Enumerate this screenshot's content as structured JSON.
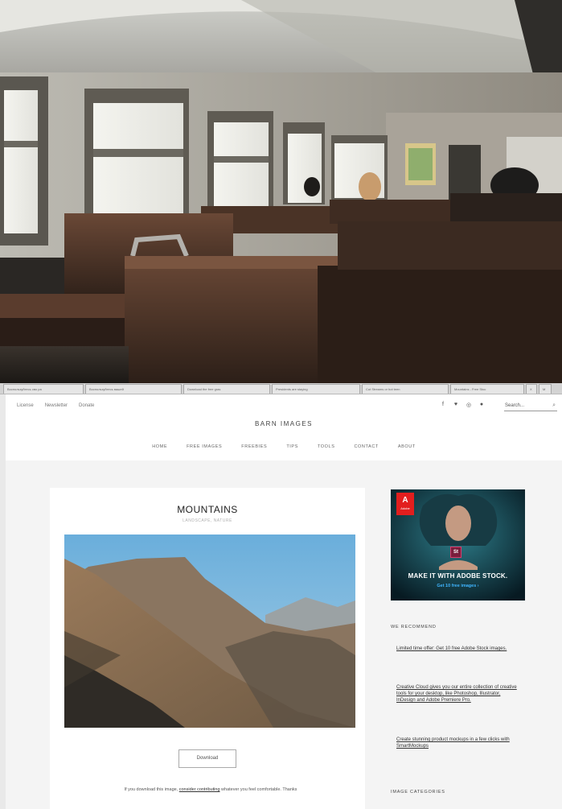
{
  "tabs": [
    "Воспользуйтесь сво ра",
    "Воспользуйтесь вашей",
    "Download the free gras",
    "Presidents are staying",
    "Cut Streams or hot teen",
    "Mountains - Free Stoc",
    "X",
    "М"
  ],
  "site": {
    "top_links": [
      "License",
      "Newsletter",
      "Donate"
    ],
    "search_placeholder": "Search...",
    "brand": "BARN IMAGES",
    "nav": [
      "HOME",
      "FREE IMAGES",
      "FREEBIES",
      "TIPS",
      "TOOLS",
      "CONTACT",
      "ABOUT"
    ]
  },
  "post": {
    "title": "MOUNTAINS",
    "category": "LANDSCAPE, NATURE",
    "download_label": "Download",
    "text_before": "If you download this image, ",
    "text_link": "consider contributing",
    "text_after": " whatever you feel comfortable. Thanks"
  },
  "sidebar": {
    "ad": {
      "logo_letter": "A",
      "logo_word": "Adobe",
      "badge": "St",
      "headline": "MAKE IT WITH ADOBE STOCK.",
      "subline": "Get 10 free images ›"
    },
    "recommend_heading": "WE RECOMMEND",
    "recommendations": [
      "Limited time offer: Get 10 free Adobe Stock images.",
      "Creative Cloud gives you our entire collection of creative tools for your desktop, like Photoshop, Illustrator, InDesign and Adobe Premiere Pro.",
      "Create stunning product mockups in a few clicks with SmartMockups"
    ],
    "categories_heading": "IMAGE CATEGORIES"
  },
  "colors": {
    "adobe_red": "#e21e1e",
    "ad_bg": "#0c2530",
    "ad_link": "#3fb5ff",
    "content_bg": "#f4f4f4"
  }
}
